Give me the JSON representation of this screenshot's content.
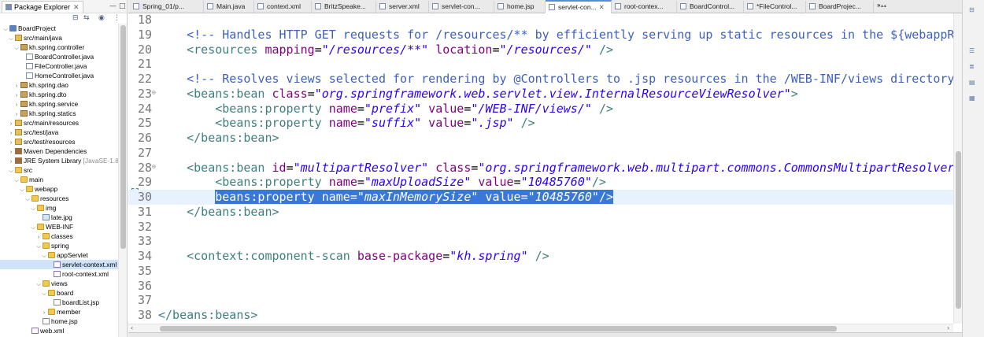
{
  "explorer": {
    "title": "Package Explorer",
    "tree": [
      {
        "label": "BoardProject",
        "icon": "project",
        "expanded": true
      },
      {
        "label": "src/main/java",
        "icon": "source-folder",
        "expanded": true
      },
      {
        "label": "kh.spring.controller",
        "icon": "package",
        "expanded": true
      },
      {
        "label": "BoardController.java",
        "icon": "java-file",
        "expanded": false
      },
      {
        "label": "FileController.java",
        "icon": "java-file",
        "expanded": false
      },
      {
        "label": "HomeController.java",
        "icon": "java-file",
        "expanded": false
      },
      {
        "label": "kh.spring.dao",
        "icon": "package",
        "expanded": false
      },
      {
        "label": "kh.spring.dto",
        "icon": "package",
        "expanded": false
      },
      {
        "label": "kh.spring.service",
        "icon": "package",
        "expanded": false
      },
      {
        "label": "kh.spring.statics",
        "icon": "package",
        "expanded": false
      },
      {
        "label": "src/main/resources",
        "icon": "source-folder",
        "expanded": false
      },
      {
        "label": "src/test/java",
        "icon": "source-folder",
        "expanded": false
      },
      {
        "label": "src/test/resources",
        "icon": "source-folder",
        "expanded": false
      },
      {
        "label": "Maven Dependencies",
        "icon": "library",
        "expanded": false
      },
      {
        "label": "JRE System Library",
        "suffix": "[JavaSE-1.8]",
        "icon": "library",
        "expanded": false
      },
      {
        "label": "src",
        "icon": "folder",
        "expanded": true
      },
      {
        "label": "main",
        "icon": "folder",
        "expanded": true
      },
      {
        "label": "webapp",
        "icon": "folder",
        "expanded": true
      },
      {
        "label": "resources",
        "icon": "folder",
        "expanded": true
      },
      {
        "label": "img",
        "icon": "folder",
        "expanded": true
      },
      {
        "label": "late.jpg",
        "icon": "image-file",
        "expanded": false
      },
      {
        "label": "WEB-INF",
        "icon": "folder",
        "expanded": true
      },
      {
        "label": "classes",
        "icon": "folder",
        "expanded": false
      },
      {
        "label": "spring",
        "icon": "folder",
        "expanded": true
      },
      {
        "label": "appServlet",
        "icon": "folder",
        "expanded": true
      },
      {
        "label": "servlet-context.xml",
        "icon": "xml-file",
        "expanded": false,
        "selected": true
      },
      {
        "label": "root-context.xml",
        "icon": "xml-file",
        "expanded": false
      },
      {
        "label": "views",
        "icon": "folder",
        "expanded": true
      },
      {
        "label": "board",
        "icon": "folder",
        "expanded": true
      },
      {
        "label": "boardList.jsp",
        "icon": "file",
        "expanded": false
      },
      {
        "label": "member",
        "icon": "folder",
        "expanded": false
      },
      {
        "label": "home.jsp",
        "icon": "file",
        "expanded": false
      },
      {
        "label": "web.xml",
        "icon": "xml-file",
        "expanded": false
      }
    ]
  },
  "tabs": [
    {
      "label": "Spring_01/p..."
    },
    {
      "label": "Main.java"
    },
    {
      "label": "context.xml"
    },
    {
      "label": "BritzSpeake..."
    },
    {
      "label": "server.xml"
    },
    {
      "label": "servlet-con..."
    },
    {
      "label": "home.jsp"
    },
    {
      "label": "servlet-con...",
      "active": true
    },
    {
      "label": "root-contex..."
    },
    {
      "label": "BoardControl..."
    },
    {
      "label": "*FileControl..."
    },
    {
      "label": "BoardProjec..."
    }
  ],
  "tab_overflow": "»₄₄",
  "editor": {
    "current_line": 30,
    "lines": [
      {
        "n": "18",
        "text": ""
      },
      {
        "n": "19",
        "text": "    <!-- Handles HTTP GET requests for /resources/** by efficiently serving up static resources in the ${webappRoot}/"
      },
      {
        "n": "20",
        "text": "    <resources mapping=\"/resources/**\" location=\"/resources/\" />"
      },
      {
        "n": "21",
        "text": ""
      },
      {
        "n": "22",
        "text": "    <!-- Resolves views selected for rendering by @Controllers to .jsp resources in the /WEB-INF/views directory -->"
      },
      {
        "n": "23",
        "fold": "⊖",
        "text": "    <beans:bean class=\"org.springframework.web.servlet.view.InternalResourceViewResolver\">"
      },
      {
        "n": "24",
        "text": "        <beans:property name=\"prefix\" value=\"/WEB-INF/views/\" />"
      },
      {
        "n": "25",
        "text": "        <beans:property name=\"suffix\" value=\".jsp\" />"
      },
      {
        "n": "26",
        "text": "    </beans:bean>"
      },
      {
        "n": "27",
        "text": ""
      },
      {
        "n": "28",
        "fold": "⊖",
        "text": "    <beans:bean id=\"multipartResolver\" class=\"org.springframework.web.multipart.commons.CommonsMultipartResolver\">"
      },
      {
        "n": "29",
        "text": "        <beans:property name=\"maxUploadSize\" value=\"10485760\"/>"
      },
      {
        "n": "30",
        "text": "        <beans:property name=\"maxInMemorySize\" value=\"10485760\"/>",
        "selection": "beans:property name=\"maxInMemorySize\" value=\"10485760\"/>"
      },
      {
        "n": "31",
        "text": "    </beans:bean>"
      },
      {
        "n": "32",
        "text": ""
      },
      {
        "n": "33",
        "text": ""
      },
      {
        "n": "34",
        "text": "    <context:component-scan base-package=\"kh.spring\" />"
      },
      {
        "n": "35",
        "text": ""
      },
      {
        "n": "36",
        "text": ""
      },
      {
        "n": "37",
        "text": ""
      },
      {
        "n": "38",
        "text": "</beans:beans>"
      }
    ]
  },
  "colors": {
    "comment": "#3f5fbf",
    "tag": "#3f7f7f",
    "attribute": "#7f007f",
    "value": "#2a00ff",
    "selection": "#3a78d6",
    "current_line": "#e8f2fe"
  }
}
